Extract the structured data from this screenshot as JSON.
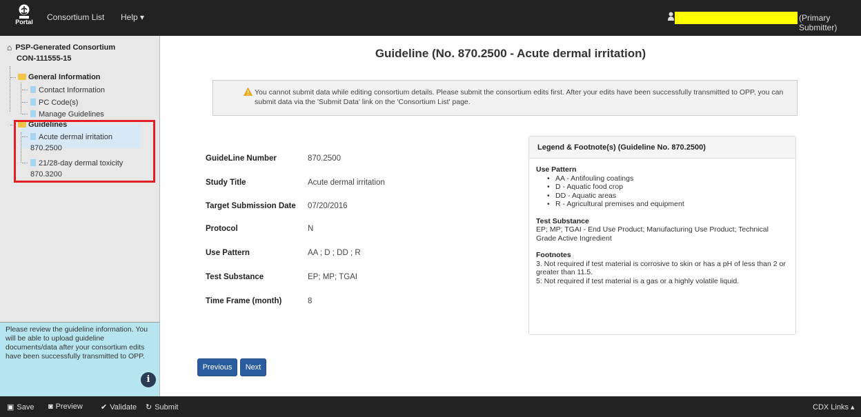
{
  "topbar": {
    "logo_text": "Portal",
    "nav": [
      "Consortium List",
      "Help ▾"
    ],
    "user_role": "(Primary Submitter)"
  },
  "sidebar": {
    "consortium_name": "PSP-Generated Consortium",
    "consortium_id": "CON-111555-15",
    "general_info": "General Information",
    "general_items": [
      "Contact Information",
      "PC Code(s)",
      "Manage Guidelines"
    ],
    "guidelines": "Guidelines",
    "guideline_items": [
      {
        "name": "Acute dermal irritation",
        "number": "870.2500"
      },
      {
        "name": "21/28-day dermal toxicity",
        "number": "870.3200"
      }
    ],
    "help_text": "Please review the guideline information. You will be able to upload guideline documents/data after your consortium edits have been successfully transmitted to OPP.",
    "info_glyph": "i"
  },
  "main": {
    "title": "Guideline (No. 870.2500 - Acute dermal irritation)",
    "alert": "You cannot submit data while editing consortium details. Please submit the consortium edits first. After your edits have been successfully transmitted to OPP, you can submit data via the 'Submit Data' link on the 'Consortium List' page.",
    "fields": [
      {
        "label": "GuideLine Number",
        "value": "870.2500"
      },
      {
        "label": "Study Title",
        "value": "Acute dermal irritation"
      },
      {
        "label": "Target Submission Date",
        "value": "07/20/2016"
      },
      {
        "label": "Protocol",
        "value": "N"
      },
      {
        "label": "Use Pattern",
        "value": "AA ; D ; DD ; R"
      },
      {
        "label": "Test Substance",
        "value": "EP; MP; TGAI"
      },
      {
        "label": "Time Frame (month)",
        "value": "8"
      }
    ],
    "legend": {
      "header": "Legend & Footnote(s) (Guideline No. 870.2500)",
      "use_pattern_title": "Use Pattern",
      "use_pattern_items": [
        "AA - Antifouling coatings",
        "D - Aquatic food crop",
        "DD - Aquatic areas",
        "R - Agricultural premises and equipment"
      ],
      "test_substance_title": "Test Substance",
      "test_substance_text": "EP; MP; TGAI - End Use Product; Manufacturing Use Product; Technical Grade Active Ingredient",
      "footnotes_title": "Footnotes",
      "footnotes": [
        "3. Not required if test material is corrosive to skin or has a pH of less than 2 or greater than 11.5.",
        "5: Not required if test material is a gas or a highly volatile liquid."
      ]
    },
    "buttons": {
      "previous": "Previous",
      "next": "Next"
    }
  },
  "bottombar": {
    "save": "Save",
    "preview": "Preview",
    "validate": "Validate",
    "submit": "Submit",
    "cdx_links": "CDX Links ▴"
  }
}
